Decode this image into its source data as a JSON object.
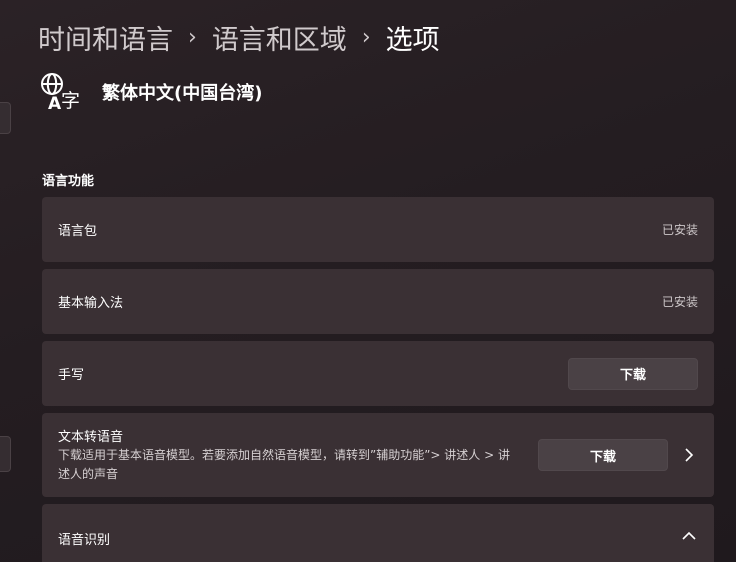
{
  "breadcrumb": {
    "items": [
      "时间和语言",
      "语言和区域"
    ],
    "separator": "›",
    "current": "选项"
  },
  "language": {
    "icon": "language-icon",
    "name": "繁体中文(中国台湾)"
  },
  "section": {
    "title": "语言功能"
  },
  "features": {
    "language_pack": {
      "label": "语言包",
      "status": "已安装"
    },
    "basic_typing": {
      "label": "基本输入法",
      "status": "已安装"
    },
    "handwriting": {
      "label": "手写",
      "button": "下载"
    },
    "tts": {
      "label": "文本转语音",
      "description": "下载适用于基本语音模型。若要添加自然语音模型，请转到”辅助功能”> 讲述人 > 讲述人的声音",
      "button": "下载",
      "chevron_icon": "chevron-right-icon"
    },
    "speech": {
      "label": "语音识别",
      "chevron_icon": "chevron-up-icon"
    }
  },
  "colors": {
    "background": "#241d21",
    "card": "#3a3034",
    "button": "#4a4145",
    "text": "#ffffff",
    "secondary_text": "#cdc7c9"
  }
}
